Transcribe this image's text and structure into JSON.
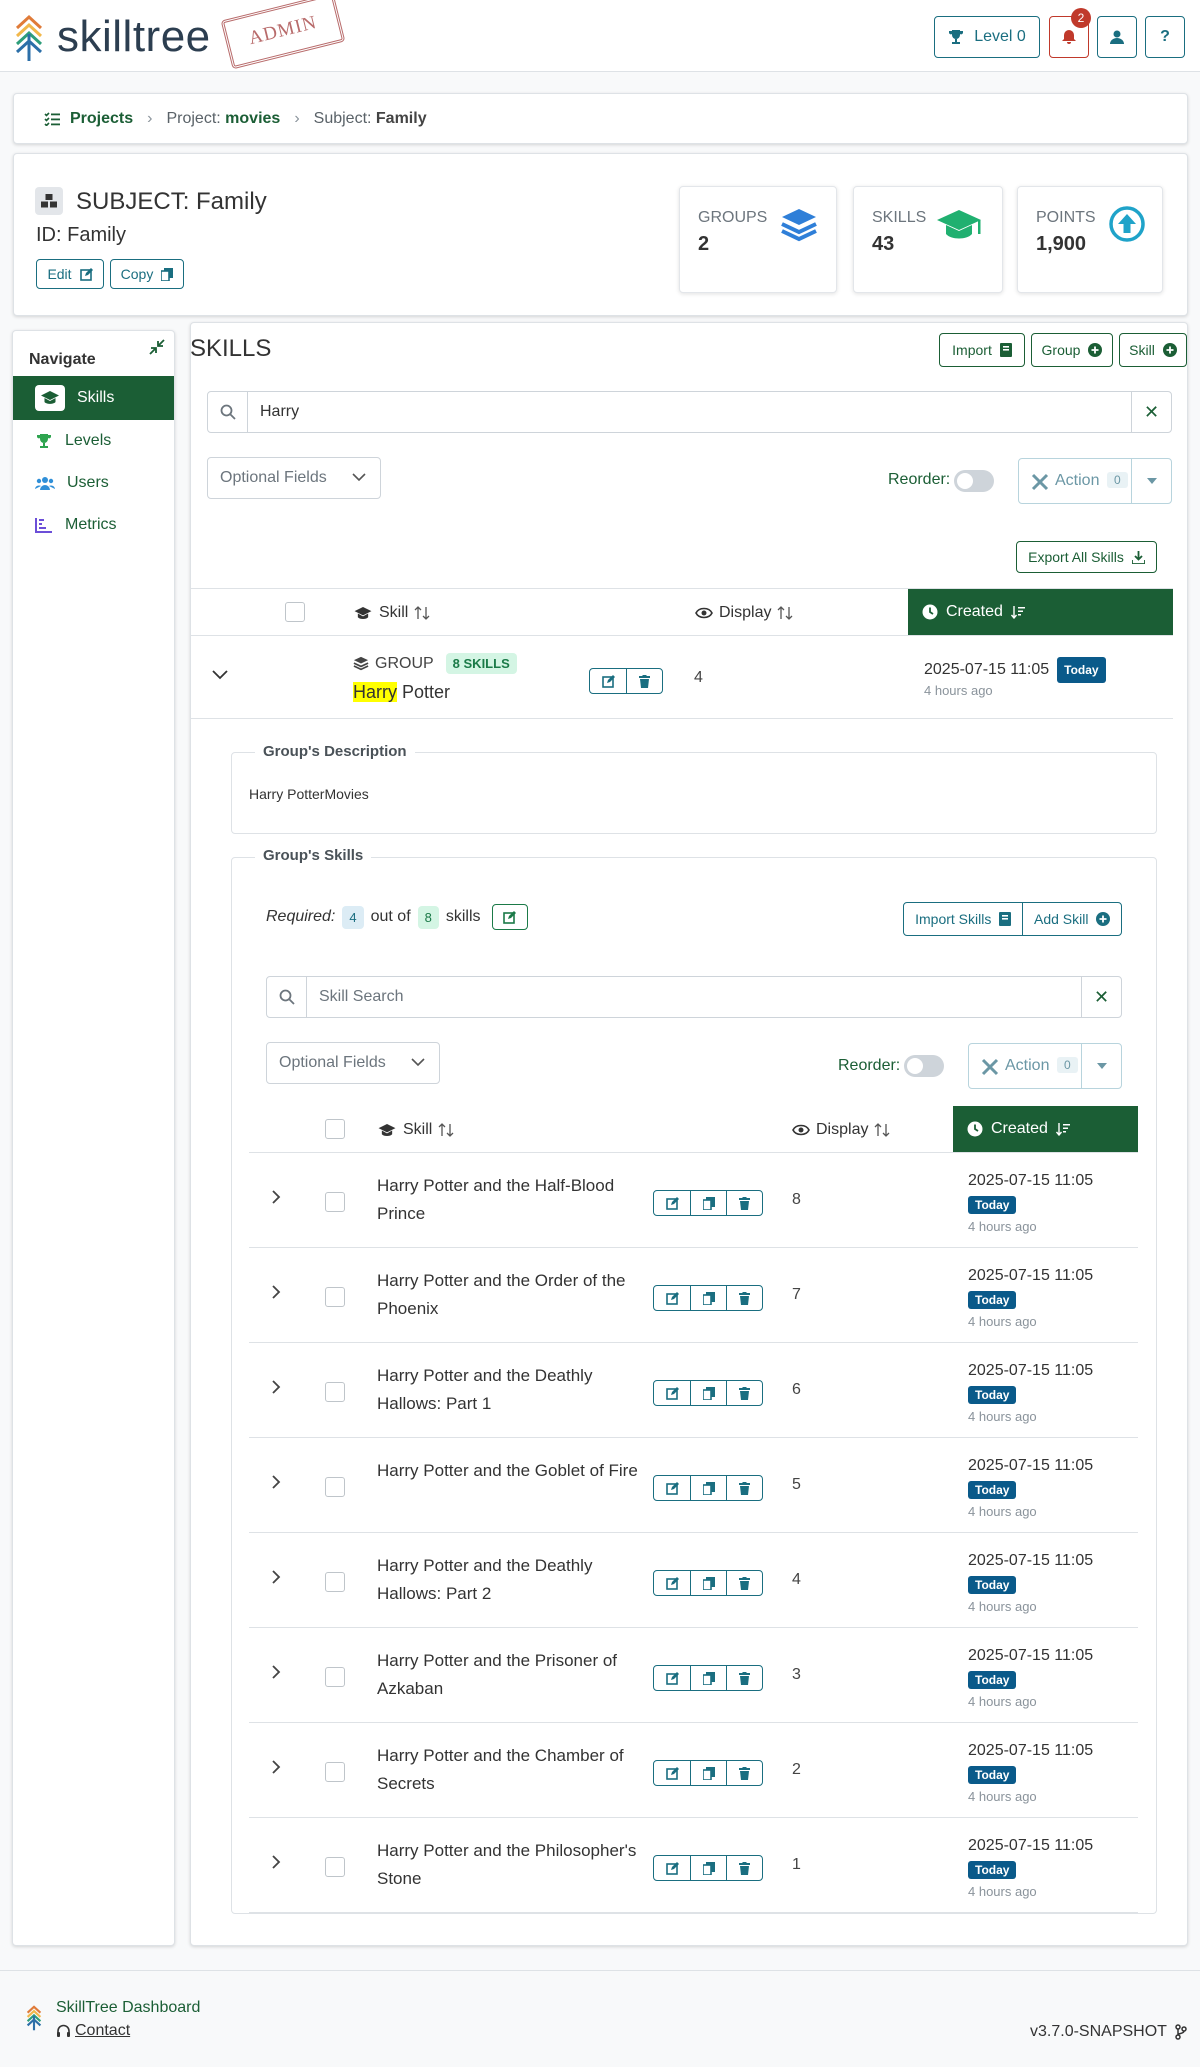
{
  "header": {
    "logo_text": "skilltree",
    "admin_stamp": "ADMIN",
    "level_label": "Level 0",
    "notification_count": "2",
    "help_label": "?"
  },
  "breadcrumb": {
    "projects": "Projects",
    "project_prefix": "Project:",
    "project_name": "movies",
    "subject_prefix": "Subject:",
    "subject_name": "Family"
  },
  "subject": {
    "title": "SUBJECT: Family",
    "id_line": "ID: Family",
    "edit_label": "Edit",
    "copy_label": "Copy",
    "stats": [
      {
        "label": "Groups",
        "value": "2"
      },
      {
        "label": "Skills",
        "value": "43"
      },
      {
        "label": "Points",
        "value": "1,900"
      }
    ]
  },
  "nav": {
    "title": "Navigate",
    "items": [
      {
        "label": "Skills"
      },
      {
        "label": "Levels"
      },
      {
        "label": "Users"
      },
      {
        "label": "Metrics"
      }
    ]
  },
  "skills": {
    "title": "SKILLS",
    "import_label": "Import",
    "group_label": "Group",
    "skill_label": "Skill",
    "search_value": "Harry",
    "optional_fields": "Optional Fields",
    "reorder_label": "Reorder:",
    "action_label": "Action",
    "action_count": "0",
    "export_label": "Export All Skills",
    "col_skill": "Skill",
    "col_display": "Display",
    "col_created": "Created"
  },
  "group": {
    "type_label": "GROUP",
    "skills_badge": "8 SKILLS",
    "name_highlight": "Harry",
    "name_rest": " Potter",
    "display": "4",
    "created": "2025-07-15 11:05",
    "today": "Today",
    "ago": "4 hours ago",
    "description_legend": "Group's Description",
    "description": "Harry PotterMovies",
    "skills_legend": "Group's Skills",
    "required_label": "Required:",
    "required_count": "4",
    "out_of": "out of",
    "total_count": "8",
    "skills_word": "skills",
    "import_skills": "Import Skills",
    "add_skill": "Add Skill",
    "search_placeholder": "Skill Search",
    "optional_fields": "Optional Fields",
    "reorder_label": "Reorder:",
    "action_label": "Action",
    "action_count": "0",
    "col_skill": "Skill",
    "col_display": "Display",
    "col_created": "Created",
    "rows": [
      {
        "name": "Harry Potter and the Half-Blood Prince",
        "display": "8",
        "created": "2025-07-15 11:05",
        "today": "Today",
        "ago": "4 hours ago"
      },
      {
        "name": "Harry Potter and the Order of the Phoenix",
        "display": "7",
        "created": "2025-07-15 11:05",
        "today": "Today",
        "ago": "4 hours ago"
      },
      {
        "name": "Harry Potter and the Deathly Hallows: Part 1",
        "display": "6",
        "created": "2025-07-15 11:05",
        "today": "Today",
        "ago": "4 hours ago"
      },
      {
        "name": "Harry Potter and the Goblet of Fire",
        "display": "5",
        "created": "2025-07-15 11:05",
        "today": "Today",
        "ago": "4 hours ago"
      },
      {
        "name": "Harry Potter and the Deathly Hallows: Part 2",
        "display": "4",
        "created": "2025-07-15 11:05",
        "today": "Today",
        "ago": "4 hours ago"
      },
      {
        "name": "Harry Potter and the Prisoner of Azkaban",
        "display": "3",
        "created": "2025-07-15 11:05",
        "today": "Today",
        "ago": "4 hours ago"
      },
      {
        "name": "Harry Potter and the Chamber of Secrets",
        "display": "2",
        "created": "2025-07-15 11:05",
        "today": "Today",
        "ago": "4 hours ago"
      },
      {
        "name": "Harry Potter and the Philosopher's Stone",
        "display": "1",
        "created": "2025-07-15 11:05",
        "today": "Today",
        "ago": "4 hours ago"
      }
    ]
  },
  "footer": {
    "dashboard": "SkillTree Dashboard",
    "contact": "Contact",
    "version": "v3.7.0-SNAPSHOT"
  },
  "colors": {
    "brand_green": "#1b5e35",
    "teal": "#1a6e80",
    "today_badge": "#0a5a8a",
    "highlight": "#ffff00"
  }
}
